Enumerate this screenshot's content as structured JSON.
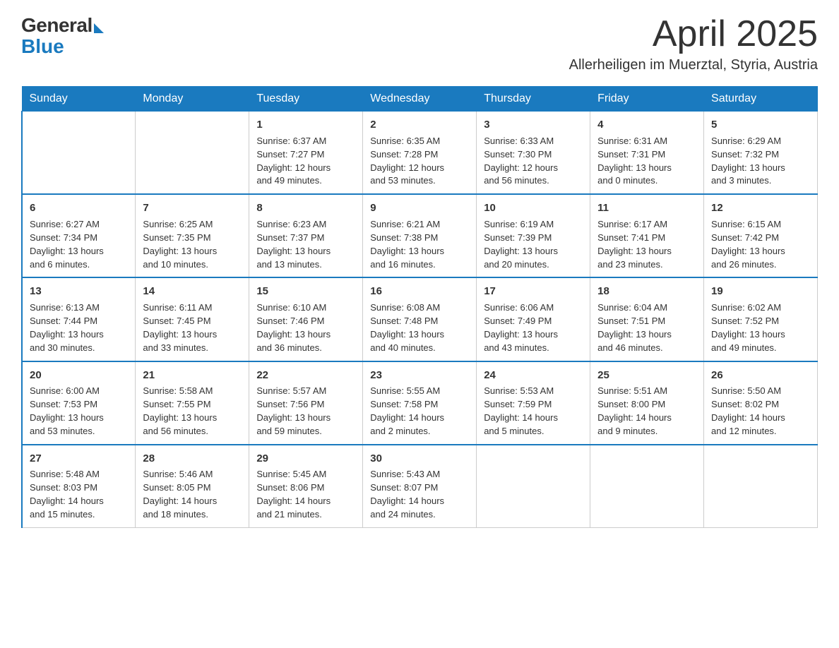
{
  "logo": {
    "general": "General",
    "blue": "Blue"
  },
  "title": "April 2025",
  "subtitle": "Allerheiligen im Muerztal, Styria, Austria",
  "days_of_week": [
    "Sunday",
    "Monday",
    "Tuesday",
    "Wednesday",
    "Thursday",
    "Friday",
    "Saturday"
  ],
  "weeks": [
    [
      {
        "day": "",
        "info": ""
      },
      {
        "day": "",
        "info": ""
      },
      {
        "day": "1",
        "info": "Sunrise: 6:37 AM\nSunset: 7:27 PM\nDaylight: 12 hours\nand 49 minutes."
      },
      {
        "day": "2",
        "info": "Sunrise: 6:35 AM\nSunset: 7:28 PM\nDaylight: 12 hours\nand 53 minutes."
      },
      {
        "day": "3",
        "info": "Sunrise: 6:33 AM\nSunset: 7:30 PM\nDaylight: 12 hours\nand 56 minutes."
      },
      {
        "day": "4",
        "info": "Sunrise: 6:31 AM\nSunset: 7:31 PM\nDaylight: 13 hours\nand 0 minutes."
      },
      {
        "day": "5",
        "info": "Sunrise: 6:29 AM\nSunset: 7:32 PM\nDaylight: 13 hours\nand 3 minutes."
      }
    ],
    [
      {
        "day": "6",
        "info": "Sunrise: 6:27 AM\nSunset: 7:34 PM\nDaylight: 13 hours\nand 6 minutes."
      },
      {
        "day": "7",
        "info": "Sunrise: 6:25 AM\nSunset: 7:35 PM\nDaylight: 13 hours\nand 10 minutes."
      },
      {
        "day": "8",
        "info": "Sunrise: 6:23 AM\nSunset: 7:37 PM\nDaylight: 13 hours\nand 13 minutes."
      },
      {
        "day": "9",
        "info": "Sunrise: 6:21 AM\nSunset: 7:38 PM\nDaylight: 13 hours\nand 16 minutes."
      },
      {
        "day": "10",
        "info": "Sunrise: 6:19 AM\nSunset: 7:39 PM\nDaylight: 13 hours\nand 20 minutes."
      },
      {
        "day": "11",
        "info": "Sunrise: 6:17 AM\nSunset: 7:41 PM\nDaylight: 13 hours\nand 23 minutes."
      },
      {
        "day": "12",
        "info": "Sunrise: 6:15 AM\nSunset: 7:42 PM\nDaylight: 13 hours\nand 26 minutes."
      }
    ],
    [
      {
        "day": "13",
        "info": "Sunrise: 6:13 AM\nSunset: 7:44 PM\nDaylight: 13 hours\nand 30 minutes."
      },
      {
        "day": "14",
        "info": "Sunrise: 6:11 AM\nSunset: 7:45 PM\nDaylight: 13 hours\nand 33 minutes."
      },
      {
        "day": "15",
        "info": "Sunrise: 6:10 AM\nSunset: 7:46 PM\nDaylight: 13 hours\nand 36 minutes."
      },
      {
        "day": "16",
        "info": "Sunrise: 6:08 AM\nSunset: 7:48 PM\nDaylight: 13 hours\nand 40 minutes."
      },
      {
        "day": "17",
        "info": "Sunrise: 6:06 AM\nSunset: 7:49 PM\nDaylight: 13 hours\nand 43 minutes."
      },
      {
        "day": "18",
        "info": "Sunrise: 6:04 AM\nSunset: 7:51 PM\nDaylight: 13 hours\nand 46 minutes."
      },
      {
        "day": "19",
        "info": "Sunrise: 6:02 AM\nSunset: 7:52 PM\nDaylight: 13 hours\nand 49 minutes."
      }
    ],
    [
      {
        "day": "20",
        "info": "Sunrise: 6:00 AM\nSunset: 7:53 PM\nDaylight: 13 hours\nand 53 minutes."
      },
      {
        "day": "21",
        "info": "Sunrise: 5:58 AM\nSunset: 7:55 PM\nDaylight: 13 hours\nand 56 minutes."
      },
      {
        "day": "22",
        "info": "Sunrise: 5:57 AM\nSunset: 7:56 PM\nDaylight: 13 hours\nand 59 minutes."
      },
      {
        "day": "23",
        "info": "Sunrise: 5:55 AM\nSunset: 7:58 PM\nDaylight: 14 hours\nand 2 minutes."
      },
      {
        "day": "24",
        "info": "Sunrise: 5:53 AM\nSunset: 7:59 PM\nDaylight: 14 hours\nand 5 minutes."
      },
      {
        "day": "25",
        "info": "Sunrise: 5:51 AM\nSunset: 8:00 PM\nDaylight: 14 hours\nand 9 minutes."
      },
      {
        "day": "26",
        "info": "Sunrise: 5:50 AM\nSunset: 8:02 PM\nDaylight: 14 hours\nand 12 minutes."
      }
    ],
    [
      {
        "day": "27",
        "info": "Sunrise: 5:48 AM\nSunset: 8:03 PM\nDaylight: 14 hours\nand 15 minutes."
      },
      {
        "day": "28",
        "info": "Sunrise: 5:46 AM\nSunset: 8:05 PM\nDaylight: 14 hours\nand 18 minutes."
      },
      {
        "day": "29",
        "info": "Sunrise: 5:45 AM\nSunset: 8:06 PM\nDaylight: 14 hours\nand 21 minutes."
      },
      {
        "day": "30",
        "info": "Sunrise: 5:43 AM\nSunset: 8:07 PM\nDaylight: 14 hours\nand 24 minutes."
      },
      {
        "day": "",
        "info": ""
      },
      {
        "day": "",
        "info": ""
      },
      {
        "day": "",
        "info": ""
      }
    ]
  ]
}
